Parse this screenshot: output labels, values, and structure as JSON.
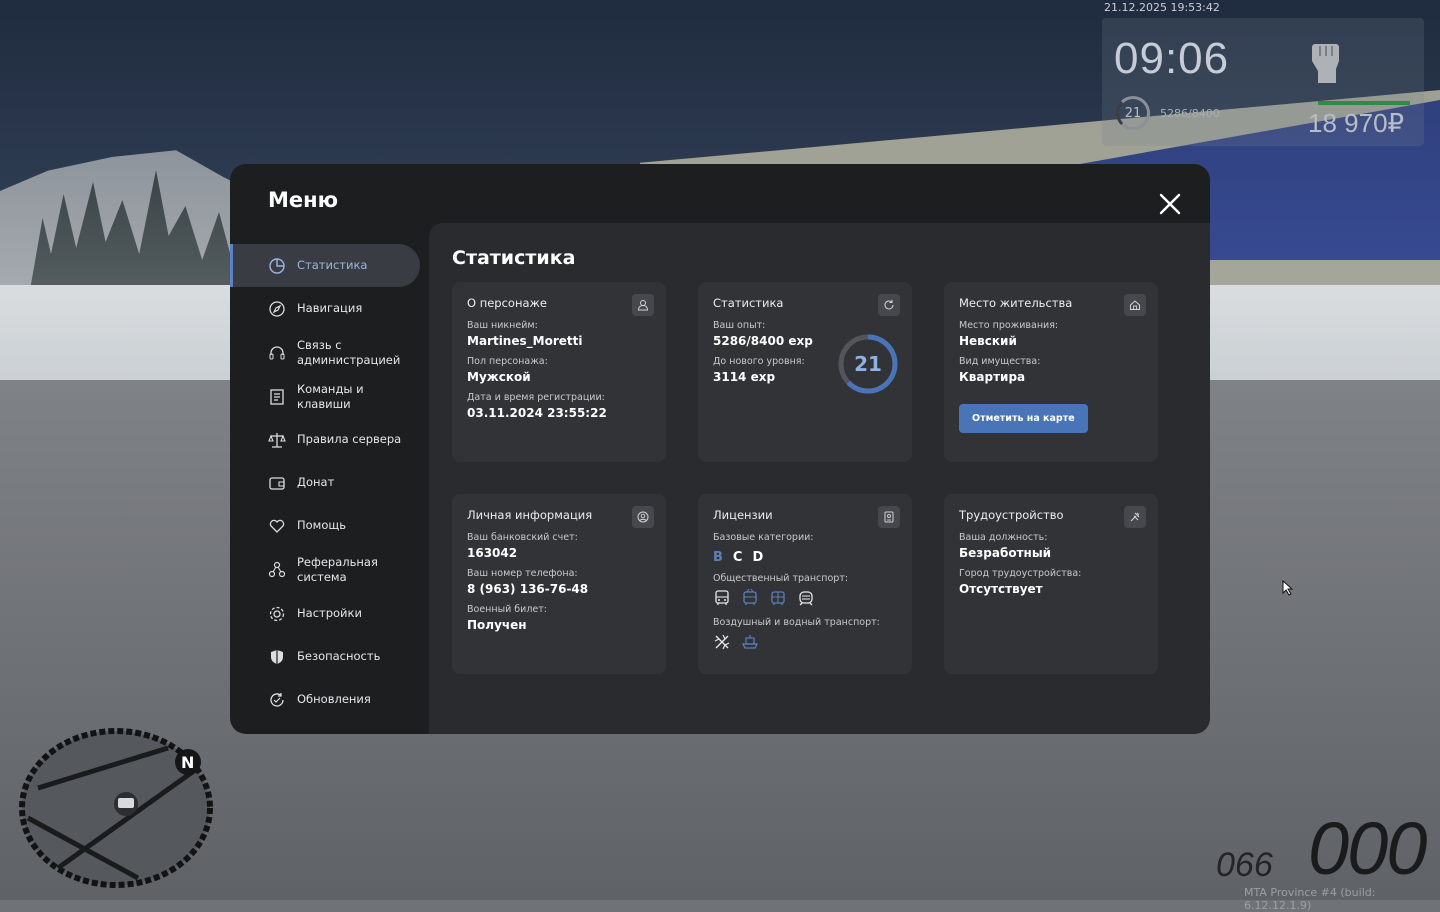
{
  "hud": {
    "datetime": "21.12.2025 19:53:42",
    "time": "09:06",
    "level": "21",
    "exp": "5286/8400",
    "money": "18 970₽",
    "build": "MTA Province #4 (build: 6.12.12.1.9)",
    "speed": "000",
    "fuel": "066"
  },
  "menu": {
    "title": "Меню",
    "close_icon": "close-icon",
    "sidebar": [
      {
        "label": "Статистика",
        "icon": "pie-chart-icon",
        "active": true
      },
      {
        "label": "Навигация",
        "icon": "compass-icon",
        "active": false
      },
      {
        "label": "Связь с администрацией",
        "icon": "headset-icon",
        "active": false
      },
      {
        "label": "Команды и клавиши",
        "icon": "document-icon",
        "active": false
      },
      {
        "label": "Правила сервера",
        "icon": "scales-icon",
        "active": false
      },
      {
        "label": "Донат",
        "icon": "wallet-icon",
        "active": false
      },
      {
        "label": "Помощь",
        "icon": "heart-hand-icon",
        "active": false
      },
      {
        "label": "Реферальная система",
        "icon": "network-icon",
        "active": false
      },
      {
        "label": "Настройки",
        "icon": "gear-icon",
        "active": false
      },
      {
        "label": "Безопасность",
        "icon": "shield-icon",
        "active": false
      },
      {
        "label": "Обновления",
        "icon": "refresh-icon",
        "active": false
      }
    ]
  },
  "content": {
    "title": "Статистика",
    "character": {
      "title": "О персонаже",
      "nickname_label": "Ваш никнейм:",
      "nickname": "Martines_Moretti",
      "gender_label": "Пол персонажа:",
      "gender": "Мужской",
      "reg_label": "Дата и время регистрации:",
      "reg": "03.11.2024 23:55:22"
    },
    "stats": {
      "title": "Статистика",
      "exp_label": "Ваш опыт:",
      "exp": "5286/8400 exp",
      "next_label": "До нового уровня:",
      "next": "3114 exp",
      "level": "21",
      "progress": 0.629
    },
    "residence": {
      "title": "Место жительства",
      "place_label": "Место проживания:",
      "place": "Невский",
      "property_label": "Вид имущества:",
      "property": "Квартира",
      "button": "Отметить на карте"
    },
    "personal": {
      "title": "Личная информация",
      "bank_label": "Ваш банковский счет:",
      "bank": "163042",
      "phone_label": "Ваш номер телефона:",
      "phone": "8 (963) 136-76-48",
      "military_label": "Военный билет:",
      "military": "Получен"
    },
    "licenses": {
      "title": "Лицензии",
      "base_label": "Базовые категории:",
      "categories": [
        "B",
        "C",
        "D"
      ],
      "public_label": "Общественный транспорт:",
      "air_label": "Воздушный и водный транспорт:"
    },
    "employment": {
      "title": "Трудоустройство",
      "position_label": "Ваша должность:",
      "position": "Безработный",
      "city_label": "Город трудоустройства:",
      "city": "Отсутствует"
    }
  },
  "colors": {
    "accent": "#4a74b8",
    "panel": "#1d1e20",
    "card": "#323337"
  }
}
